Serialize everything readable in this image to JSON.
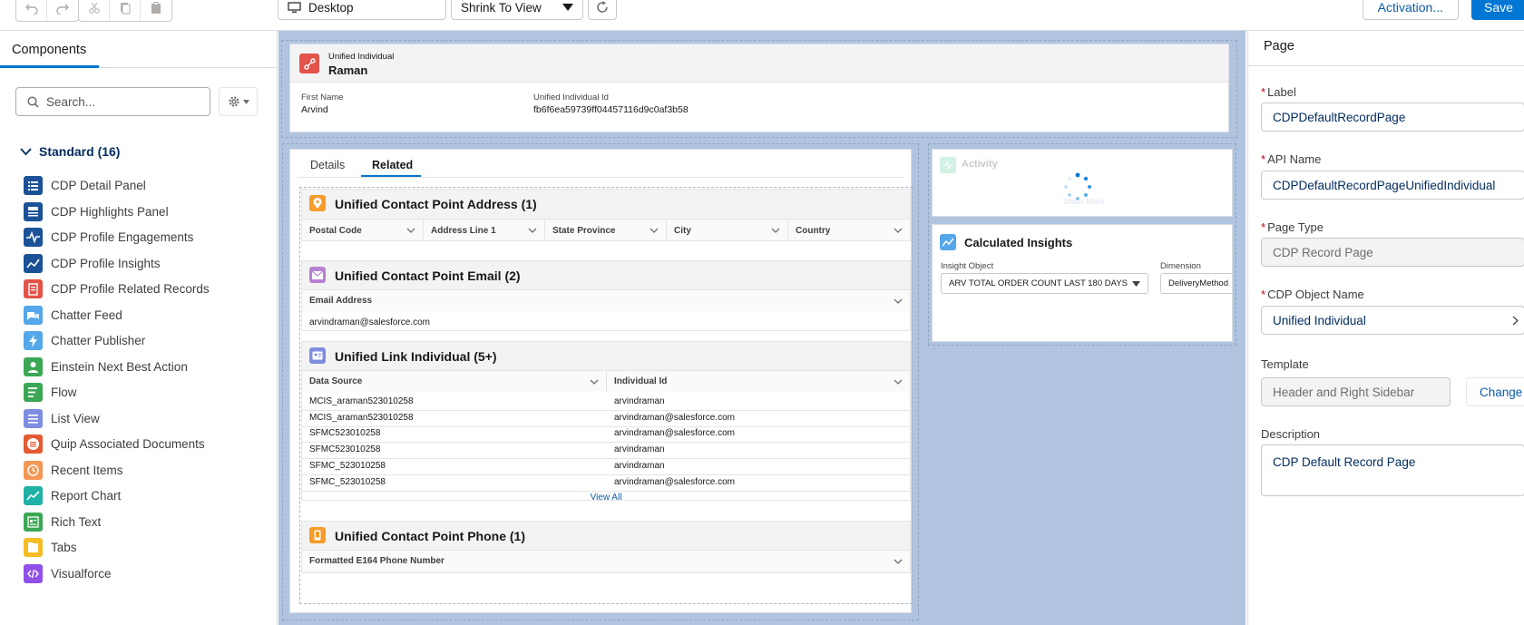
{
  "toolbar": {
    "device_label": "Desktop",
    "view_label": "Shrink To View",
    "activation_label": "Activation...",
    "save_label": "Save"
  },
  "sidebar": {
    "tab_label": "Components",
    "search_placeholder": "Search...",
    "standard_header": "Standard (16)",
    "items": [
      {
        "label": "CDP Detail Panel",
        "icon": "list-icon",
        "color": "#1b5297"
      },
      {
        "label": "CDP Highlights Panel",
        "icon": "highlights-icon",
        "color": "#1b5297"
      },
      {
        "label": "CDP Profile Engagements",
        "icon": "pulse-icon",
        "color": "#1b5297"
      },
      {
        "label": "CDP Profile Insights",
        "icon": "insights-icon",
        "color": "#1b5297"
      },
      {
        "label": "CDP Profile Related Records",
        "icon": "related-records-icon",
        "color": "#e3534a"
      },
      {
        "label": "Chatter Feed",
        "icon": "chatter-feed-icon",
        "color": "#54a7e8"
      },
      {
        "label": "Chatter Publisher",
        "icon": "lightning-icon",
        "color": "#54a7e8"
      },
      {
        "label": "Einstein Next Best Action",
        "icon": "einstein-icon",
        "color": "#3ba755"
      },
      {
        "label": "Flow",
        "icon": "flow-icon",
        "color": "#3ba755"
      },
      {
        "label": "List View",
        "icon": "list-view-icon",
        "color": "#7f8de1"
      },
      {
        "label": "Quip Associated Documents",
        "icon": "quip-icon",
        "color": "#e45a33"
      },
      {
        "label": "Recent Items",
        "icon": "clock-icon",
        "color": "#f49756"
      },
      {
        "label": "Report Chart",
        "icon": "report-chart-icon",
        "color": "#1fb1a6"
      },
      {
        "label": "Rich Text",
        "icon": "rich-text-icon",
        "color": "#3ba755"
      },
      {
        "label": "Tabs",
        "icon": "tabs-icon",
        "color": "#f4bc25"
      },
      {
        "label": "Visualforce",
        "icon": "visualforce-icon",
        "color": "#9050e9"
      }
    ]
  },
  "highlights": {
    "object_label": "Unified Individual",
    "record_name": "Raman",
    "field1_label": "First Name",
    "field1_value": "Arvind",
    "field2_label": "Unified Individual Id",
    "field2_value": "fb6f6ea59739ff04457116d9c0af3b58"
  },
  "tabs": {
    "details": "Details",
    "related": "Related"
  },
  "related": {
    "address": {
      "title": "Unified Contact Point Address (1)",
      "columns": [
        "Postal Code",
        "Address Line 1",
        "State Province",
        "City",
        "Country"
      ]
    },
    "email": {
      "title": "Unified Contact Point Email (2)",
      "column": "Email Address",
      "value": "arvindraman@salesforce.com"
    },
    "link": {
      "title": "Unified Link Individual (5+)",
      "columns": [
        "Data Source",
        "Individual Id"
      ],
      "rows": [
        [
          "MCIS_araman523010258",
          "arvindraman"
        ],
        [
          "MCIS_araman523010258",
          "arvindraman@salesforce.com"
        ],
        [
          "SFMC523010258",
          "arvindraman@salesforce.com"
        ],
        [
          "SFMC523010258",
          "arvindraman"
        ],
        [
          "SFMC_523010258",
          "arvindraman"
        ],
        [
          "SFMC_523010258",
          "arvindraman@salesforce.com"
        ]
      ],
      "view_all": "View All"
    },
    "phone": {
      "title": "Unified Contact Point Phone (1)",
      "column": "Formatted E164 Phone Number"
    }
  },
  "activity": {
    "title": "Activity",
    "show_more": "Show More"
  },
  "insights": {
    "title": "Calculated Insights",
    "object_label": "Insight Object",
    "object_value": "ARV TOTAL ORDER COUNT LAST 180 DAYS",
    "dimension_label": "Dimension",
    "dimension_value": "DeliveryMethod"
  },
  "props": {
    "title": "Page",
    "label_label": "Label",
    "label_value": "CDPDefaultRecordPage",
    "api_label": "API Name",
    "api_value": "CDPDefaultRecordPageUnifiedIndividual",
    "type_label": "Page Type",
    "type_value": "CDP Record Page",
    "object_label": "CDP Object Name",
    "object_value": "Unified Individual",
    "template_label": "Template",
    "template_value": "Header and Right Sidebar",
    "change_label": "Change",
    "desc_label": "Description",
    "desc_value": "CDP Default Record Page"
  },
  "colors": {
    "brand": "#0176d3",
    "canvas_bg": "#b0c4df",
    "address_icon": "#f59c2b",
    "email_icon": "#b781d3",
    "link_icon": "#7f8de1",
    "phone_icon": "#f59c2b",
    "insights_icon": "#54a7e8",
    "highlights_icon": "#e3534a"
  }
}
